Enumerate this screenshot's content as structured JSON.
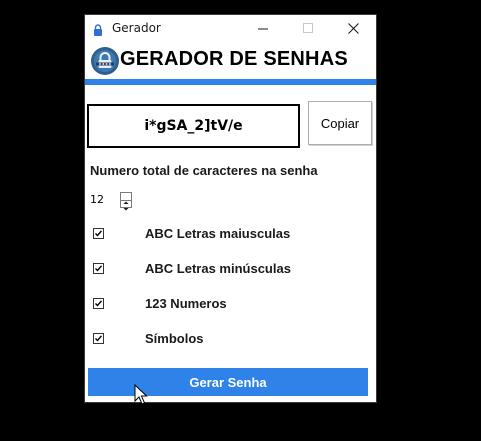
{
  "window": {
    "title": "Gerador",
    "controls": [
      "minimize",
      "maximize",
      "close"
    ]
  },
  "header": {
    "title": "GERADOR DE SENHAS",
    "logo_icon": "lock-shield-icon",
    "accent_color": "#2e82e8"
  },
  "password": {
    "value": "i*gSA_2]tV/e",
    "copy_label": "Copiar"
  },
  "length": {
    "label": "Numero total de caracteres na senha",
    "value": "12"
  },
  "options": [
    {
      "label": "ABC Letras maiusculas",
      "checked": true
    },
    {
      "label": "ABC Letras minúsculas",
      "checked": true
    },
    {
      "label": "123 Numeros",
      "checked": true
    },
    {
      "label": "Símbolos",
      "checked": true
    }
  ],
  "generate": {
    "label": "Gerar Senha"
  }
}
